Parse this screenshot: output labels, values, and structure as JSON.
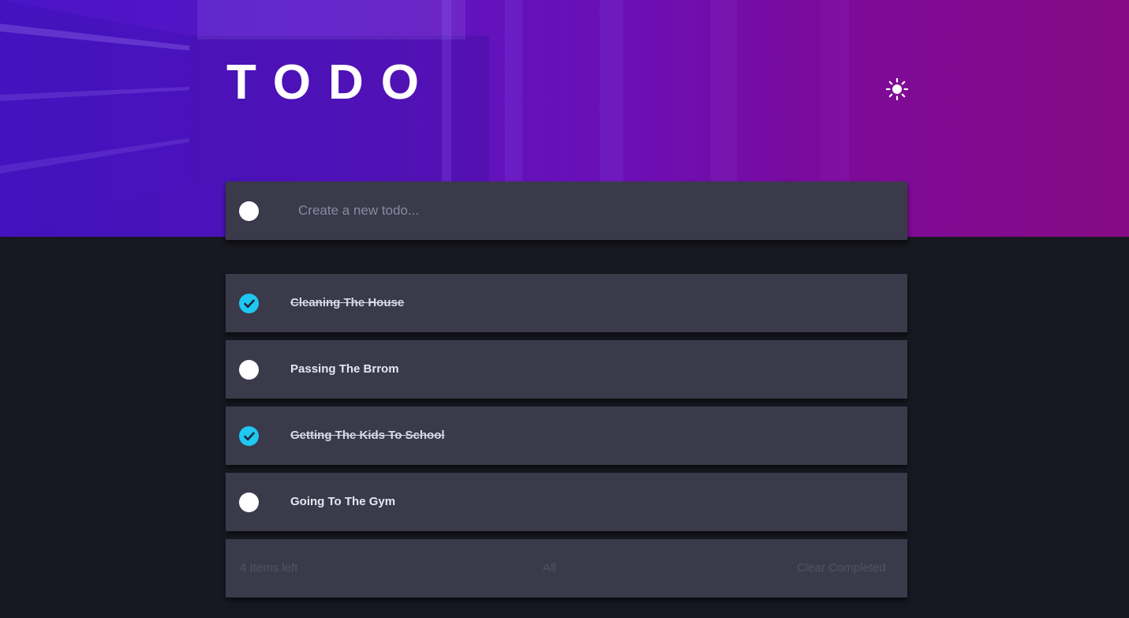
{
  "header": {
    "title": "TODO",
    "theme_toggle_icon": "sun-icon"
  },
  "new_todo": {
    "placeholder": "Create a new todo...",
    "value": ""
  },
  "todos": [
    {
      "label": "Cleaning The House",
      "completed": true
    },
    {
      "label": "Passing The Brrom",
      "completed": false
    },
    {
      "label": "Getting The Kids To School",
      "completed": true
    },
    {
      "label": "Going To The Gym",
      "completed": false
    }
  ],
  "footer": {
    "items_left": "4 Items left",
    "filter_all": "All",
    "clear_completed": "Clear Completed"
  },
  "colors": {
    "background": "#171821",
    "panel": "#3a3a4b",
    "check_accent": "#1ec8f0",
    "hero_start": "#4a14c7",
    "hero_end": "#860a84"
  }
}
